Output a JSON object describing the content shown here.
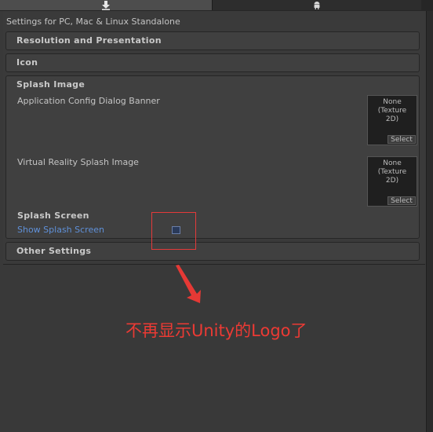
{
  "tabs": [
    {
      "icon": "download-arrow-icon"
    },
    {
      "icon": "android-icon"
    }
  ],
  "platform_title": "Settings for PC, Mac & Linux Standalone",
  "sections": {
    "resolution": "Resolution and Presentation",
    "icon": "Icon",
    "splash": "Splash Image",
    "other": "Other Settings"
  },
  "splash": {
    "config_banner_label": "Application Config Dialog Banner",
    "vr_splash_label": "Virtual Reality Splash Image",
    "texture_none_line1": "None",
    "texture_none_line2": "(Texture",
    "texture_none_line3": "2D)",
    "texture_select": "Select",
    "splash_screen_header": "Splash Screen",
    "show_splash_label": "Show Splash Screen",
    "show_splash_checked": false
  },
  "annotation": {
    "text": "不再显示Unity的Logo了",
    "color": "#ec3a34"
  }
}
